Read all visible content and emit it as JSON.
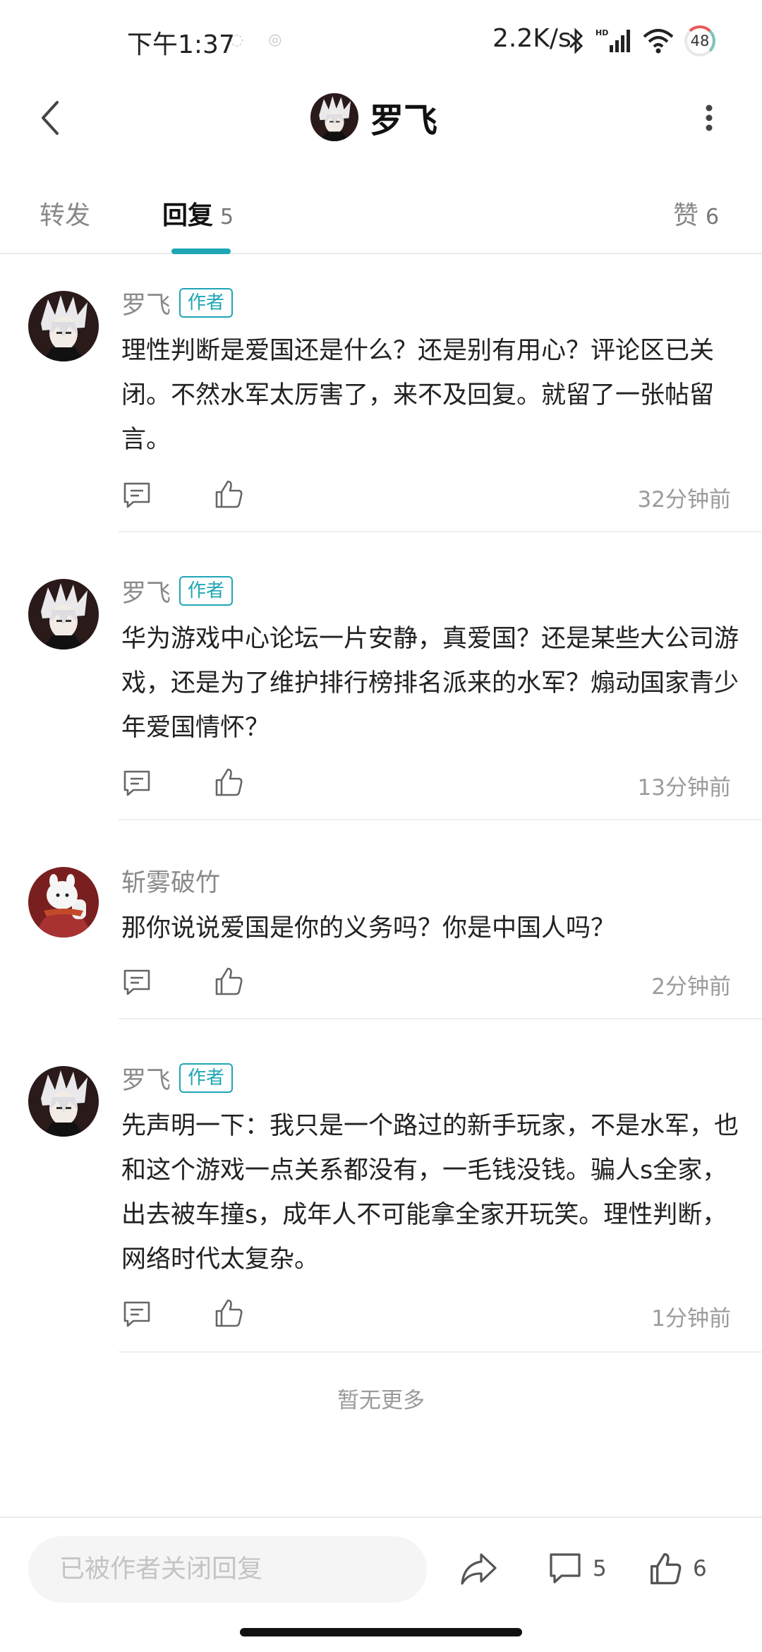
{
  "status": {
    "time": "下午1:37",
    "speed": "2.2K/s",
    "battery": "48"
  },
  "header": {
    "title": "罗飞"
  },
  "tabs": {
    "repost": "转发",
    "reply": "回复",
    "reply_count": "5",
    "like": "赞",
    "like_count": "6"
  },
  "comments": [
    {
      "name": "罗飞",
      "badge": "作者",
      "text": "理性判断是爱国还是什么？还是别有用心？评论区已关闭。不然水军太厉害了，来不及回复。就留了一张帖留言。",
      "time": "32分钟前"
    },
    {
      "name": "罗飞",
      "badge": "作者",
      "text": "华为游戏中心论坛一片安静，真爱国？还是某些大公司游戏，还是为了维护排行榜排名派来的水军？煽动国家青少年爱国情怀？",
      "time": "13分钟前"
    },
    {
      "name": "斩雾破竹",
      "badge": "",
      "text": "那你说说爱国是你的义务吗？你是中国人吗？",
      "time": "2分钟前"
    },
    {
      "name": "罗飞",
      "badge": "作者",
      "text": "先声明一下：我只是一个路过的新手玩家，不是水军，也和这个游戏一点关系都没有，一毛钱没钱。骗人s全家，出去被车撞s，成年人不可能拿全家开玩笑。理性判断，网络时代太复杂。",
      "time": "1分钟前"
    }
  ],
  "no_more": "暂无更多",
  "bottom": {
    "input_placeholder": "已被作者关闭回复",
    "comment_count": "5",
    "like_count": "6"
  },
  "colors": {
    "accent": "#1fa6b5",
    "muted_text": "#9b9b9b"
  }
}
